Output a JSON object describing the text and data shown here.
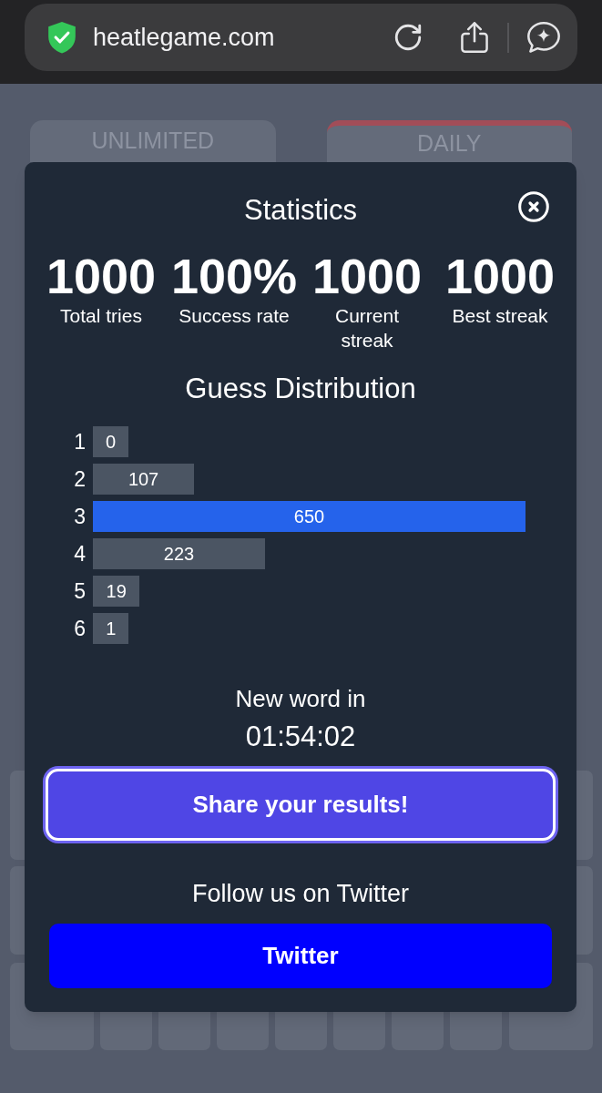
{
  "browser": {
    "url": "heatlegame.com"
  },
  "tabs": [
    {
      "label": "UNLIMITED",
      "selected": false
    },
    {
      "label": "DAILY",
      "selected": true
    }
  ],
  "dialog": {
    "title": "Statistics",
    "stats": [
      {
        "value": "1000",
        "label": "Total tries"
      },
      {
        "value": "100%",
        "label": "Success rate"
      },
      {
        "value": "1000",
        "label": "Current streak"
      },
      {
        "value": "1000",
        "label": "Best streak"
      }
    ],
    "distribution_title": "Guess Distribution",
    "distribution": [
      {
        "guess": "1",
        "count": "0",
        "level": 0.082,
        "highlighted": false
      },
      {
        "guess": "2",
        "count": "107",
        "level": 0.234,
        "highlighted": false
      },
      {
        "guess": "3",
        "count": "650",
        "level": 1,
        "highlighted": true
      },
      {
        "guess": "4",
        "count": "223",
        "level": 0.398,
        "highlighted": false
      },
      {
        "guess": "5",
        "count": "19",
        "level": 0.108,
        "highlighted": false
      },
      {
        "guess": "6",
        "count": "1",
        "level": 0.083,
        "highlighted": false
      }
    ],
    "countdown_label": "New word in",
    "countdown": "01:54:02",
    "share_button": "Share your results!",
    "follow_text": "Follow us on Twitter",
    "twitter_button": "Twitter"
  }
}
